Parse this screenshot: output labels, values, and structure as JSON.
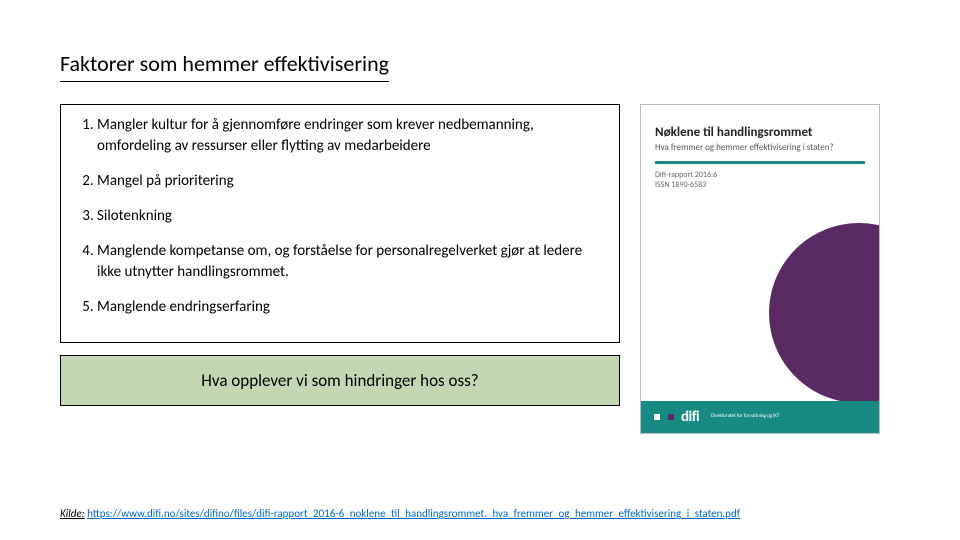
{
  "title": "Faktorer som hemmer effektivisering",
  "list": {
    "items": [
      "Mangler kultur for å gjennomføre endringer som krever nedbemanning, omfordeling av ressurser eller flytting av medarbeidere",
      "Mangel på prioritering",
      "Silotenkning",
      "Manglende kompetanse om, og forståelse for personalregelverket gjør at ledere ikke utnytter handlingsrommet.",
      "Manglende endringserfaring"
    ]
  },
  "question": "Hva opplever vi som hindringer hos oss?",
  "cover": {
    "title": "Nøklene til handlingsrommet",
    "subtitle": "Hva fremmer og hemmer effektivisering i staten?",
    "meta1": "Difi-rapport 2016:6",
    "meta2": "ISSN 1890-6583",
    "logo": "difi",
    "logo_sub": "Direktoratet for forvaltning og IKT"
  },
  "source": {
    "label": "Kilde:",
    "url": "https://www.difi.no/sites/difino/files/difi-rapport_2016-6_noklene_til_handlingsrommet._hva_fremmer_og_hemmer_effektivisering_i_staten.pdf"
  }
}
